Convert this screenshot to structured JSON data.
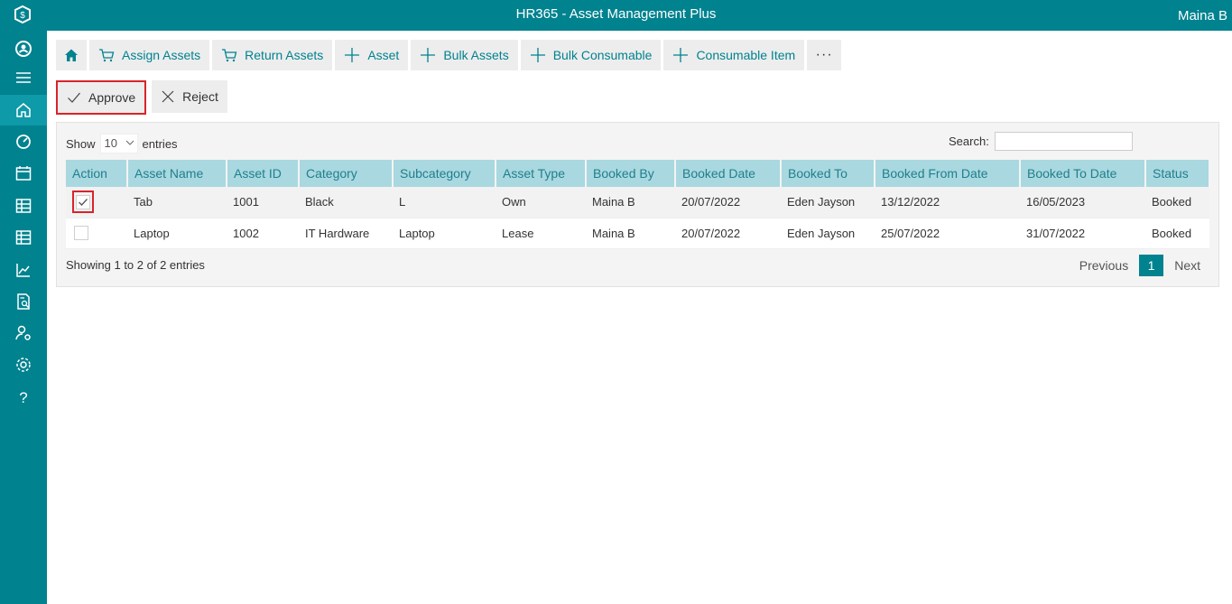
{
  "header": {
    "title": "HR365 - Asset Management Plus",
    "user": "Maina B"
  },
  "sidebar": {
    "icons": [
      "people-icon",
      "menu-icon",
      "home-icon",
      "dashboard-icon",
      "calendar-icon",
      "table-icon",
      "grid-icon",
      "chart-icon",
      "report-icon",
      "user-settings-icon",
      "settings-icon",
      "help-icon"
    ]
  },
  "toolbar": {
    "assign_assets": "Assign Assets",
    "return_assets": "Return Assets",
    "asset": "Asset",
    "bulk_assets": "Bulk Assets",
    "bulk_consumable": "Bulk Consumable",
    "consumable_item": "Consumable Item",
    "more": "···"
  },
  "actions": {
    "approve": "Approve",
    "reject": "Reject"
  },
  "table": {
    "show_label": "Show",
    "length_value": "10",
    "entries_label": "entries",
    "search_label": "Search:",
    "columns": [
      "Action",
      "Asset Name",
      "Asset ID",
      "Category",
      "Subcategory",
      "Asset Type",
      "Booked By",
      "Booked Date",
      "Booked To",
      "Booked From Date",
      "Booked To Date",
      "Status"
    ],
    "rows": [
      {
        "checked": true,
        "cells": [
          "Tab",
          "1001",
          "Black",
          "L",
          "Own",
          "Maina B",
          "20/07/2022",
          "Eden Jayson",
          "13/12/2022",
          "16/05/2023",
          "Booked"
        ]
      },
      {
        "checked": false,
        "cells": [
          "Laptop",
          "1002",
          "IT Hardware",
          "Laptop",
          "Lease",
          "Maina B",
          "20/07/2022",
          "Eden Jayson",
          "25/07/2022",
          "31/07/2022",
          "Booked"
        ]
      }
    ],
    "info": "Showing 1 to 2 of 2 entries",
    "previous": "Previous",
    "page": "1",
    "next": "Next"
  },
  "colors": {
    "brand": "#00828f",
    "header_row": "#a9d8e0",
    "highlight": "#d9232a"
  }
}
